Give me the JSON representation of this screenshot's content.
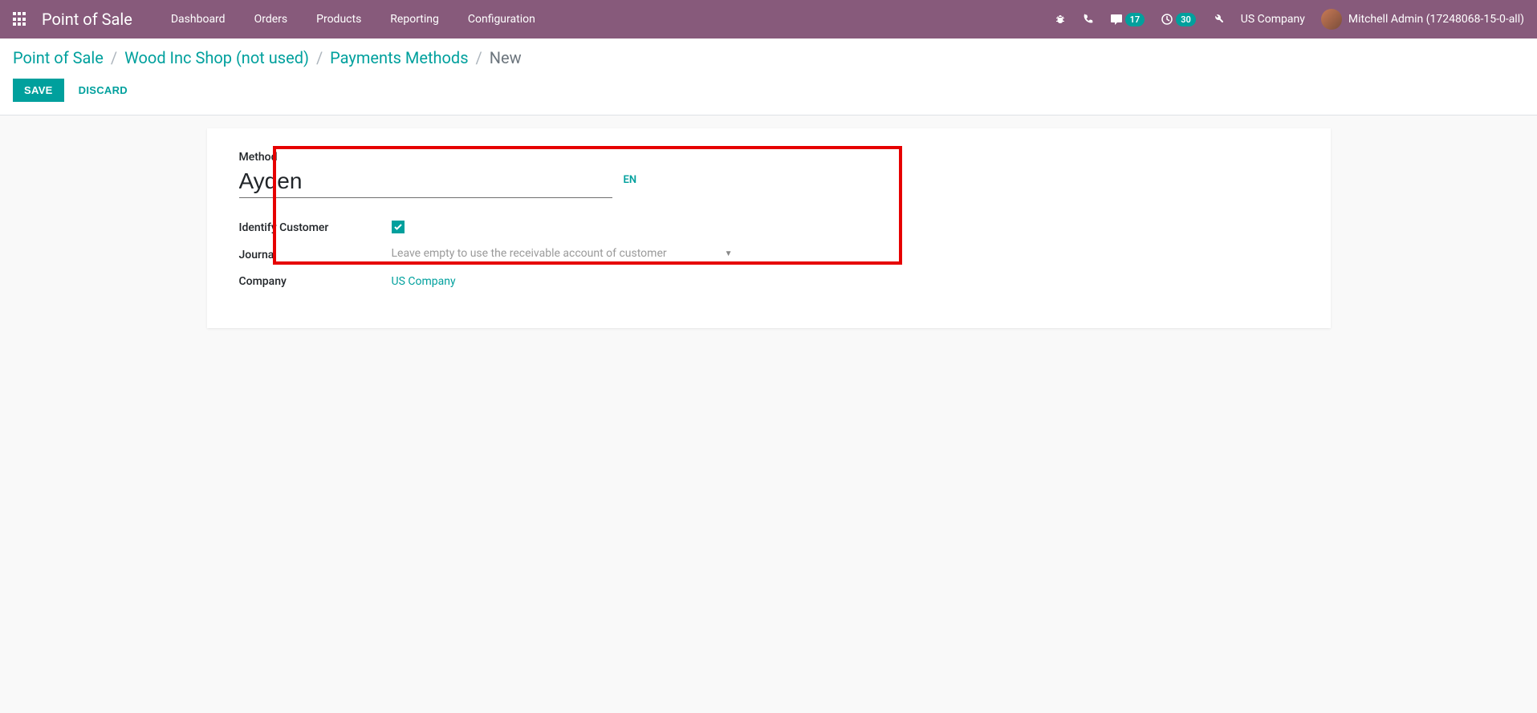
{
  "navbar": {
    "brand": "Point of Sale",
    "items": [
      "Dashboard",
      "Orders",
      "Products",
      "Reporting",
      "Configuration"
    ],
    "conversations_badge": "17",
    "activities_badge": "30",
    "company": "US Company",
    "user": "Mitchell Admin (17248068-15-0-all)"
  },
  "breadcrumbs": {
    "items": [
      "Point of Sale",
      "Wood Inc Shop (not used)",
      "Payments Methods"
    ],
    "current": "New"
  },
  "actions": {
    "save": "SAVE",
    "discard": "DISCARD"
  },
  "form": {
    "method_label": "Method",
    "method_value": "Ayden",
    "lang": "EN",
    "identify_customer_label": "Identify Customer",
    "identify_customer_checked": true,
    "journal_label": "Journal",
    "journal_placeholder": "Leave empty to use the receivable account of customer",
    "company_label": "Company",
    "company_value": "US Company"
  }
}
